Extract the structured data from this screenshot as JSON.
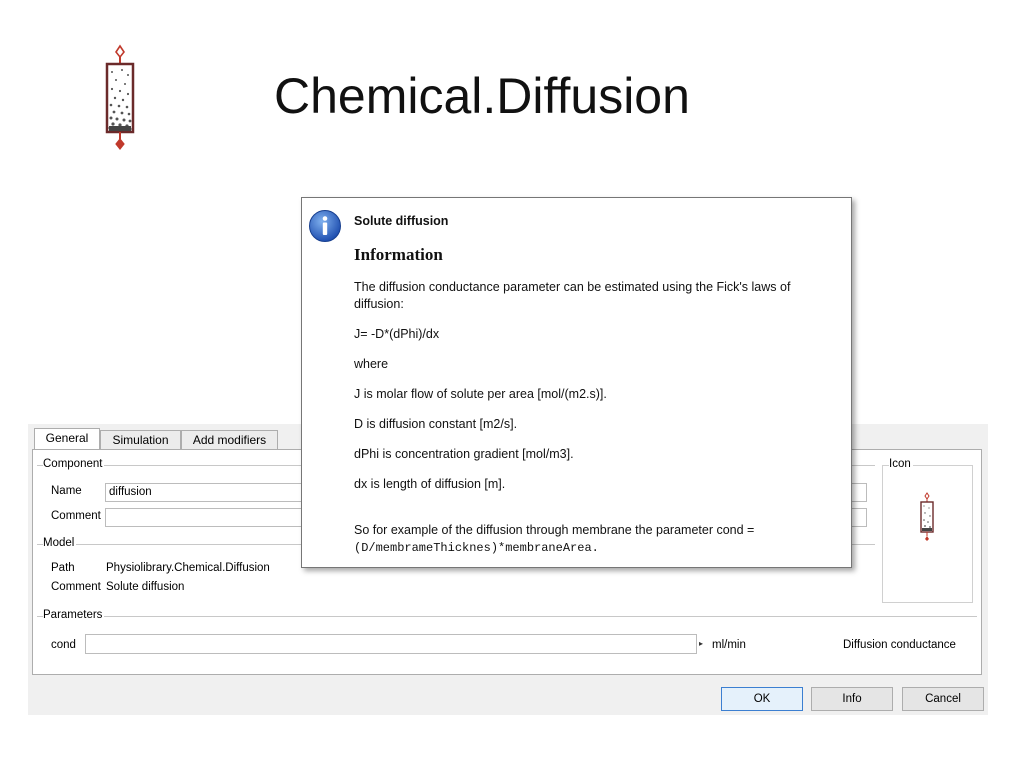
{
  "slide": {
    "title": "Chemical.Diffusion"
  },
  "dialog": {
    "tabs": [
      {
        "label": "General"
      },
      {
        "label": "Simulation"
      },
      {
        "label": "Add modifiers"
      }
    ],
    "component": {
      "group_label": "Component",
      "name_label": "Name",
      "name_value": "diffusion",
      "comment_label": "Comment",
      "comment_value": ""
    },
    "icon_group": {
      "label": "Icon"
    },
    "model": {
      "group_label": "Model",
      "path_label": "Path",
      "path_value": "Physiolibrary.Chemical.Diffusion",
      "comment_label": "Comment",
      "comment_value": "Solute diffusion"
    },
    "parameters": {
      "group_label": "Parameters",
      "items": [
        {
          "name": "cond",
          "value": "",
          "unit": "ml/min",
          "description": "Diffusion conductance"
        }
      ]
    },
    "buttons": {
      "ok": "OK",
      "info": "Info",
      "cancel": "Cancel"
    }
  },
  "tooltip": {
    "title": "Solute diffusion",
    "heading": "Information",
    "lines": [
      "The diffusion conductance parameter can be estimated using the Fick's laws of",
      "diffusion:",
      "J= -D*(dPhi)/dx",
      "where",
      "J is molar flow of solute per area [mol/(m2.s)].",
      "D is diffusion constant [m2/s].",
      "dPhi is concentration gradient [mol/m3].",
      "dx is length of diffusion [m].",
      "So for example of the diffusion through membrane the parameter cond =",
      "(D/membrameThicknes)*membraneArea."
    ]
  },
  "icons": {
    "info": "info-icon",
    "component": "diffusion-component-icon",
    "dropdown": "dropdown-arrow-icon"
  }
}
